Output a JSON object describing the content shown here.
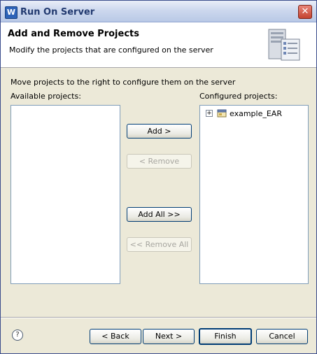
{
  "window": {
    "title": "Run On Server",
    "app_icon": "W",
    "close_glyph": "✕"
  },
  "banner": {
    "title": "Add and Remove Projects",
    "description": "Modify the projects that are configured on the server",
    "icon": "server-icon"
  },
  "main": {
    "instruction": "Move projects to the right to configure them on the server",
    "available_label": "Available projects:",
    "configured_label": "Configured projects:",
    "available_projects": [],
    "configured_projects": [
      {
        "label": "example_EAR",
        "expander": "+",
        "icon": "ear-project-icon"
      }
    ],
    "buttons": {
      "add": "Add >",
      "remove": "< Remove",
      "add_all": "Add All >>",
      "remove_all": "<< Remove All"
    }
  },
  "footer": {
    "help_glyph": "?",
    "back": "< Back",
    "next": "Next >",
    "finish": "Finish",
    "cancel": "Cancel"
  }
}
